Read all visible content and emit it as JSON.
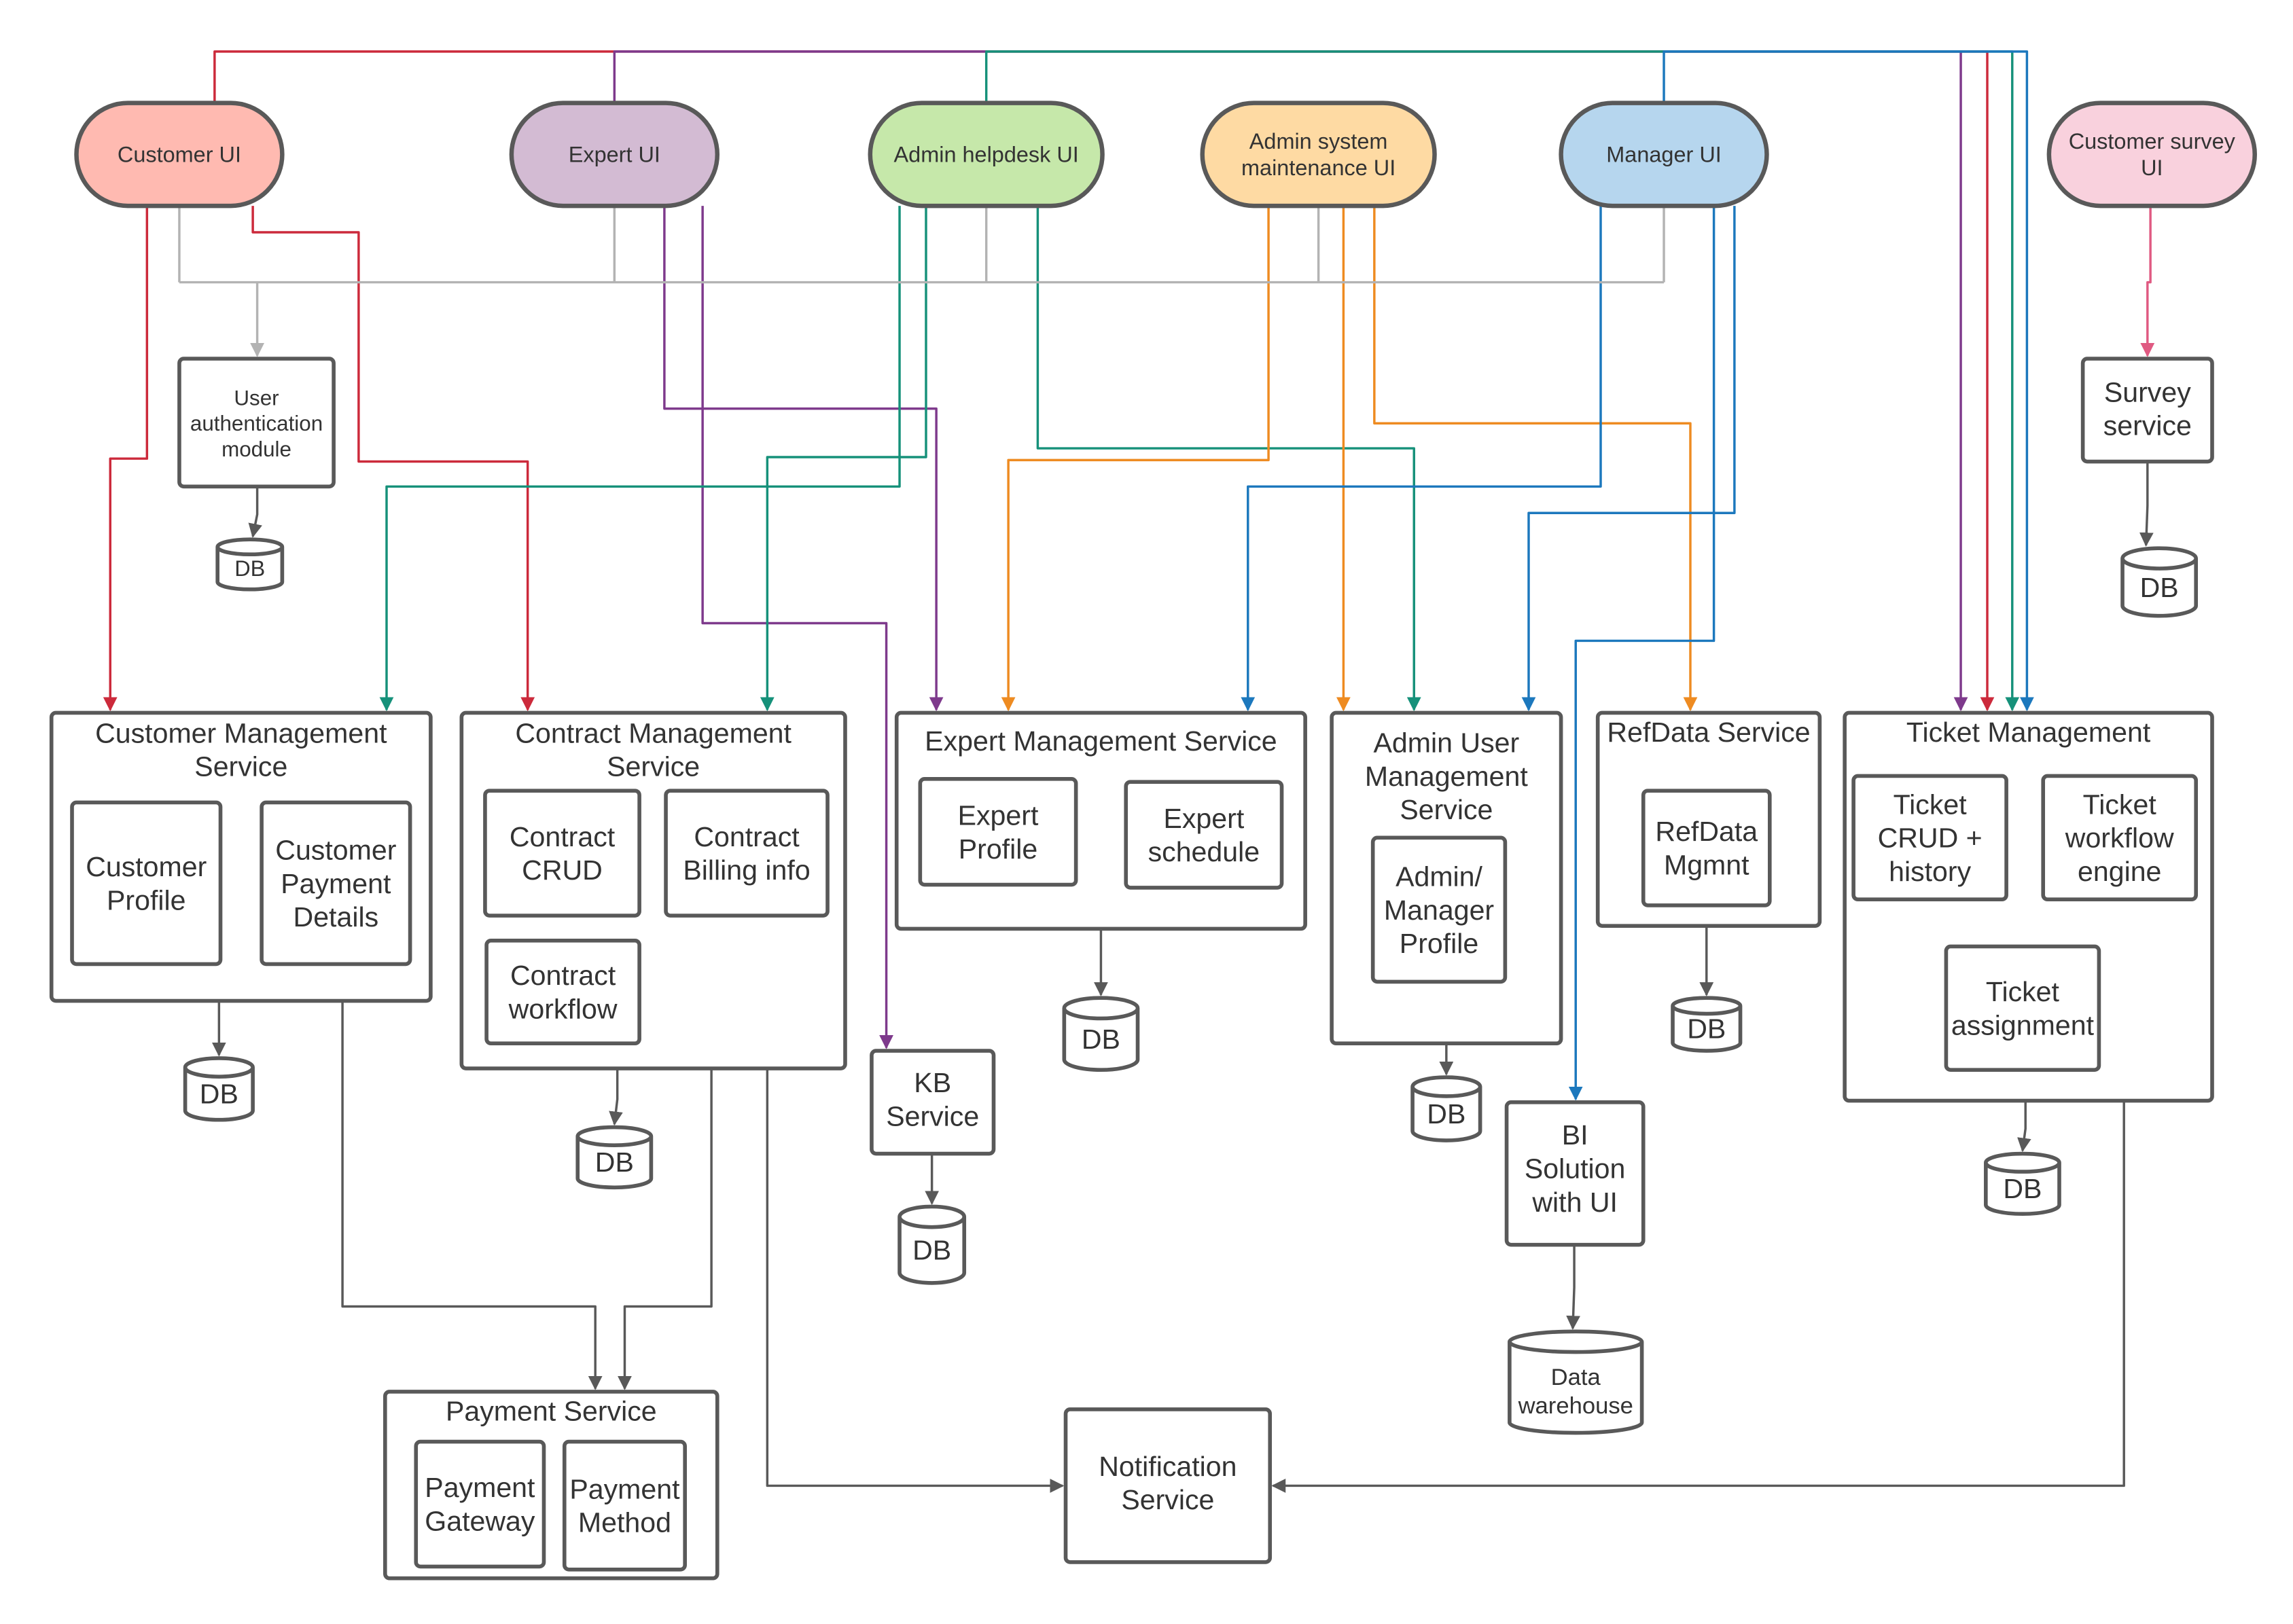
{
  "colors": {
    "customer": "#cc2a3b",
    "expert": "#7e3a8c",
    "admin_helpdesk": "#16917a",
    "admin_system": "#ee8b21",
    "manager": "#1c78bd",
    "auth": "#b3b3b3",
    "survey": "#e05a82",
    "internal": "#595959"
  },
  "ui_nodes": [
    {
      "id": "customer_ui",
      "lines": [
        "Customer UI"
      ],
      "fill": "#ffbab1"
    },
    {
      "id": "expert_ui",
      "lines": [
        "Expert UI"
      ],
      "fill": "#d3bbd3"
    },
    {
      "id": "admin_helpdesk_ui",
      "lines": [
        "Admin helpdesk UI"
      ],
      "fill": "#c6e8aa"
    },
    {
      "id": "admin_system_ui",
      "lines": [
        "Admin system",
        "maintenance UI"
      ],
      "fill": "#fedaa3"
    },
    {
      "id": "manager_ui",
      "lines": [
        "Manager UI"
      ],
      "fill": "#b6d6ee"
    },
    {
      "id": "customer_survey_ui",
      "lines": [
        "Customer survey",
        "UI"
      ],
      "fill": "#f9d1dd"
    }
  ],
  "services": [
    {
      "id": "user_auth",
      "lines": [
        "User",
        "authentication",
        "module"
      ]
    },
    {
      "id": "customer_mgmt",
      "lines": [
        "Customer  Management",
        "Service"
      ],
      "components": [
        [
          "Customer",
          "Profile"
        ],
        [
          "Customer",
          "Payment",
          "Details"
        ]
      ]
    },
    {
      "id": "contract_mgmt",
      "lines": [
        "Contract Management",
        "Service"
      ],
      "components": [
        [
          "Contract",
          "CRUD"
        ],
        [
          "Contract",
          "Billing info"
        ],
        [
          "Contract",
          "workflow"
        ]
      ]
    },
    {
      "id": "expert_mgmt",
      "lines": [
        "Expert Management Service"
      ],
      "components": [
        [
          "Expert",
          "Profile"
        ],
        [
          "Expert",
          "schedule"
        ]
      ]
    },
    {
      "id": "admin_user_mgmt",
      "lines": [
        "Admin User",
        "Management",
        "Service"
      ],
      "components": [
        [
          "Admin/",
          "Manager",
          "Profile"
        ]
      ]
    },
    {
      "id": "refdata",
      "lines": [
        "RefData Service"
      ],
      "components": [
        [
          "RefData",
          "Mgmnt"
        ]
      ]
    },
    {
      "id": "ticket_mgmt",
      "lines": [
        "Ticket Management"
      ],
      "components": [
        [
          "Ticket",
          "CRUD +",
          "history"
        ],
        [
          "Ticket",
          "workflow",
          "engine"
        ],
        [
          "Ticket",
          "assignment"
        ]
      ]
    },
    {
      "id": "kb",
      "lines": [
        "KB",
        "Service"
      ]
    },
    {
      "id": "bi",
      "lines": [
        "BI",
        "Solution",
        "with UI"
      ]
    },
    {
      "id": "survey",
      "lines": [
        "Survey",
        "service"
      ]
    },
    {
      "id": "payment",
      "lines": [
        "Payment Service"
      ],
      "components": [
        [
          "Payment",
          "Gateway"
        ],
        [
          "Payment",
          "Method"
        ]
      ]
    },
    {
      "id": "notification",
      "lines": [
        "Notification",
        "Service"
      ]
    }
  ],
  "databases": [
    {
      "id": "db_auth",
      "label": "DB"
    },
    {
      "id": "db_customer",
      "label": "DB"
    },
    {
      "id": "db_contract",
      "label": "DB"
    },
    {
      "id": "db_expert",
      "label": "DB"
    },
    {
      "id": "db_admin",
      "label": "DB"
    },
    {
      "id": "db_refdata",
      "label": "DB"
    },
    {
      "id": "db_ticket",
      "label": "DB"
    },
    {
      "id": "db_kb",
      "label": "DB"
    },
    {
      "id": "db_survey",
      "label": "DB"
    },
    {
      "id": "data_warehouse",
      "label": [
        "Data",
        "warehouse"
      ]
    }
  ],
  "edges": [
    {
      "from": "customer_ui",
      "to": "ticket_mgmt",
      "color": "customer"
    },
    {
      "from": "customer_ui",
      "to": "customer_mgmt",
      "color": "customer"
    },
    {
      "from": "customer_ui",
      "to": "contract_mgmt",
      "color": "customer"
    },
    {
      "from": "expert_ui",
      "to": "ticket_mgmt",
      "color": "expert"
    },
    {
      "from": "expert_ui",
      "to": "expert_mgmt",
      "color": "expert"
    },
    {
      "from": "expert_ui",
      "to": "kb",
      "color": "expert"
    },
    {
      "from": "admin_helpdesk_ui",
      "to": "ticket_mgmt",
      "color": "admin_helpdesk"
    },
    {
      "from": "admin_helpdesk_ui",
      "to": "customer_mgmt",
      "color": "admin_helpdesk"
    },
    {
      "from": "admin_helpdesk_ui",
      "to": "contract_mgmt",
      "color": "admin_helpdesk"
    },
    {
      "from": "admin_helpdesk_ui",
      "to": "admin_user_mgmt",
      "color": "admin_helpdesk"
    },
    {
      "from": "admin_system_ui",
      "to": "expert_mgmt",
      "color": "admin_system"
    },
    {
      "from": "admin_system_ui",
      "to": "admin_user_mgmt",
      "color": "admin_system"
    },
    {
      "from": "admin_system_ui",
      "to": "refdata",
      "color": "admin_system"
    },
    {
      "from": "manager_ui",
      "to": "ticket_mgmt",
      "color": "manager"
    },
    {
      "from": "manager_ui",
      "to": "expert_mgmt",
      "color": "manager"
    },
    {
      "from": "manager_ui",
      "to": "admin_user_mgmt",
      "color": "manager"
    },
    {
      "from": "manager_ui",
      "to": "bi",
      "color": "manager"
    },
    {
      "from": "all_ui",
      "to": "user_auth",
      "color": "auth"
    },
    {
      "from": "customer_survey_ui",
      "to": "survey",
      "color": "survey"
    },
    {
      "from": "user_auth",
      "to": "db_auth",
      "color": "internal"
    },
    {
      "from": "customer_mgmt",
      "to": "db_customer",
      "color": "internal"
    },
    {
      "from": "contract_mgmt",
      "to": "db_contract",
      "color": "internal"
    },
    {
      "from": "expert_mgmt",
      "to": "db_expert",
      "color": "internal"
    },
    {
      "from": "admin_user_mgmt",
      "to": "db_admin",
      "color": "internal"
    },
    {
      "from": "refdata",
      "to": "db_refdata",
      "color": "internal"
    },
    {
      "from": "ticket_mgmt",
      "to": "db_ticket",
      "color": "internal"
    },
    {
      "from": "kb",
      "to": "db_kb",
      "color": "internal"
    },
    {
      "from": "survey",
      "to": "db_survey",
      "color": "internal"
    },
    {
      "from": "bi",
      "to": "data_warehouse",
      "color": "internal"
    },
    {
      "from": "customer_mgmt",
      "to": "payment",
      "color": "internal"
    },
    {
      "from": "contract_mgmt",
      "to": "payment",
      "color": "internal"
    },
    {
      "from": "contract_mgmt",
      "to": "notification",
      "color": "internal"
    },
    {
      "from": "ticket_mgmt",
      "to": "notification",
      "color": "internal"
    }
  ]
}
